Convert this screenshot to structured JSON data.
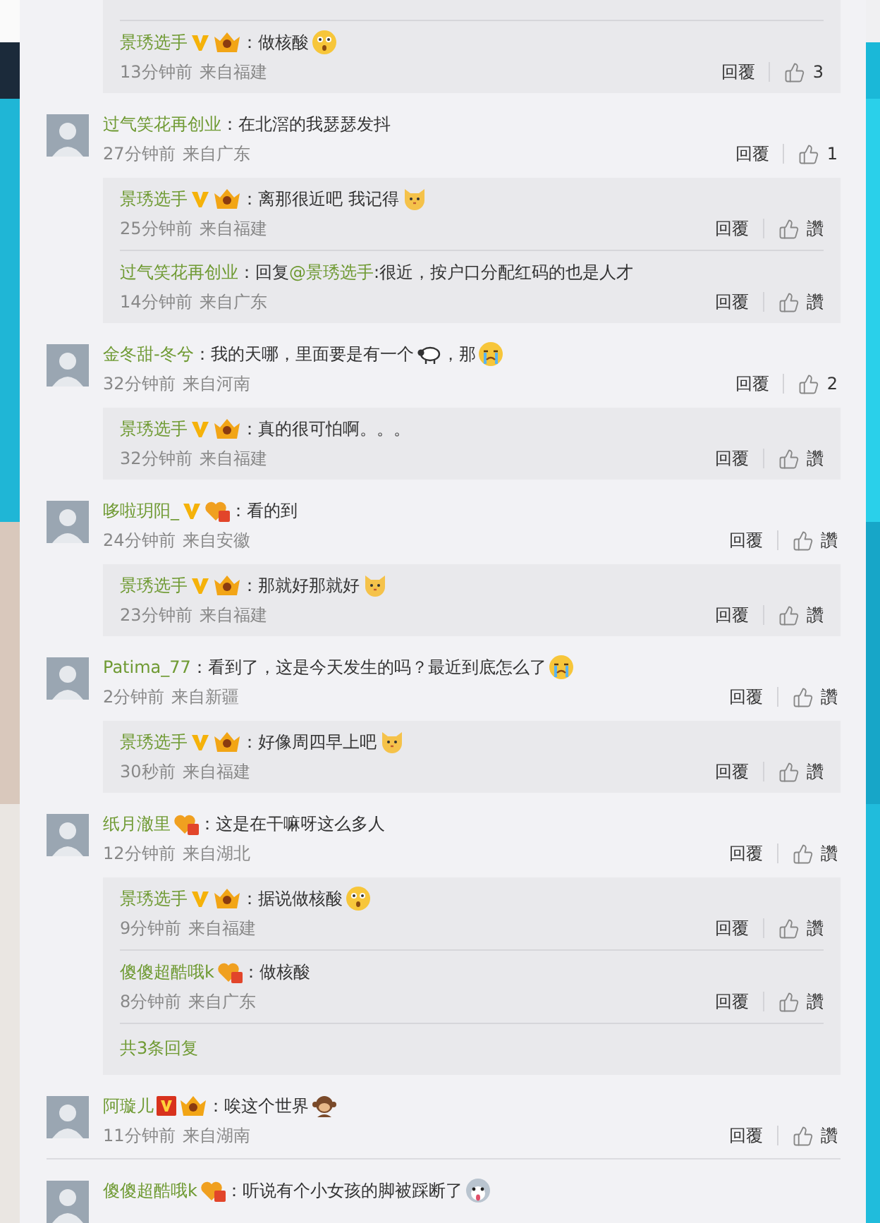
{
  "continued_replies": [
    {
      "user": "景琇选手",
      "badges": [
        {
          "kind": "v"
        },
        {
          "kind": "crown"
        }
      ],
      "content": [
        {
          "kind": "text",
          "text": "：做核酸"
        },
        {
          "kind": "surprised"
        }
      ],
      "time": "13分钟前",
      "source": "来自福建",
      "reply_label": "回覆",
      "like": "3"
    }
  ],
  "comments": [
    {
      "user": "过气笑花再创业",
      "content": [
        {
          "kind": "text",
          "text": "：在北滘的我瑟瑟发抖"
        }
      ],
      "time": "27分钟前",
      "source": "来自广东",
      "reply_label": "回覆",
      "like": "1",
      "replies": [
        {
          "user": "景琇选手",
          "badges": [
            {
              "kind": "v"
            },
            {
              "kind": "crown"
            }
          ],
          "content": [
            {
              "kind": "text",
              "text": "：离那很近吧 我记得"
            },
            {
              "kind": "cat"
            }
          ],
          "time": "25分钟前",
          "source": "来自福建",
          "reply_label": "回覆",
          "like": "讚"
        },
        {
          "user": "过气笑花再创业",
          "content": [
            {
              "kind": "text",
              "text": "：回复"
            },
            {
              "kind": "mention",
              "text": "@景琇选手"
            },
            {
              "kind": "text",
              "text": ":很近，按户口分配红码的也是人才"
            }
          ],
          "time": "14分钟前",
          "source": "来自广东",
          "reply_label": "回覆",
          "like": "讚"
        }
      ]
    },
    {
      "user": "金冬甜-冬兮",
      "content": [
        {
          "kind": "text",
          "text": "：我的天哪，里面要是有一个"
        },
        {
          "kind": "sheep"
        },
        {
          "kind": "text",
          "text": "，那"
        },
        {
          "kind": "crying"
        }
      ],
      "time": "32分钟前",
      "source": "来自河南",
      "reply_label": "回覆",
      "like": "2",
      "replies": [
        {
          "user": "景琇选手",
          "badges": [
            {
              "kind": "v"
            },
            {
              "kind": "crown"
            }
          ],
          "content": [
            {
              "kind": "text",
              "text": "：真的很可怕啊。。。"
            }
          ],
          "time": "32分钟前",
          "source": "来自福建",
          "reply_label": "回覆",
          "like": "讚"
        }
      ]
    },
    {
      "user": "哆啦玥阳_",
      "badges": [
        {
          "kind": "v"
        },
        {
          "kind": "heart"
        }
      ],
      "content": [
        {
          "kind": "text",
          "text": "：看的到"
        }
      ],
      "time": "24分钟前",
      "source": "来自安徽",
      "reply_label": "回覆",
      "like": "讚",
      "replies": [
        {
          "user": "景琇选手",
          "badges": [
            {
              "kind": "v"
            },
            {
              "kind": "crown"
            }
          ],
          "content": [
            {
              "kind": "text",
              "text": "：那就好那就好"
            },
            {
              "kind": "cat"
            }
          ],
          "time": "23分钟前",
          "source": "来自福建",
          "reply_label": "回覆",
          "like": "讚"
        }
      ]
    },
    {
      "user": "Patima_77",
      "content": [
        {
          "kind": "text",
          "text": "：看到了，这是今天发生的吗？最近到底怎么了"
        },
        {
          "kind": "crying"
        }
      ],
      "time": "2分钟前",
      "source": "来自新疆",
      "reply_label": "回覆",
      "like": "讚",
      "replies": [
        {
          "user": "景琇选手",
          "badges": [
            {
              "kind": "v"
            },
            {
              "kind": "crown"
            }
          ],
          "content": [
            {
              "kind": "text",
              "text": "：好像周四早上吧"
            },
            {
              "kind": "cat"
            }
          ],
          "time": "30秒前",
          "source": "来自福建",
          "reply_label": "回覆",
          "like": "讚"
        }
      ]
    },
    {
      "user": "纸月澈里",
      "badges": [
        {
          "kind": "heart"
        }
      ],
      "content": [
        {
          "kind": "text",
          "text": "：这是在干嘛呀这么多人"
        }
      ],
      "time": "12分钟前",
      "source": "来自湖北",
      "reply_label": "回覆",
      "like": "讚",
      "replies": [
        {
          "user": "景琇选手",
          "badges": [
            {
              "kind": "v"
            },
            {
              "kind": "crown"
            }
          ],
          "content": [
            {
              "kind": "text",
              "text": "：据说做核酸"
            },
            {
              "kind": "surprised"
            }
          ],
          "time": "9分钟前",
          "source": "来自福建",
          "reply_label": "回覆",
          "like": "讚"
        },
        {
          "user": "傻傻超酷哦k",
          "badges": [
            {
              "kind": "heart"
            }
          ],
          "content": [
            {
              "kind": "text",
              "text": "：做核酸"
            }
          ],
          "time": "8分钟前",
          "source": "来自广东",
          "reply_label": "回覆",
          "like": "讚"
        }
      ],
      "more": "共3条回复"
    },
    {
      "user": "阿璇儿",
      "badges": [
        {
          "kind": "v-box"
        },
        {
          "kind": "crown"
        }
      ],
      "content": [
        {
          "kind": "text",
          "text": "：唉这个世界"
        },
        {
          "kind": "monkey"
        }
      ],
      "time": "11分钟前",
      "source": "来自湖南",
      "reply_label": "回覆",
      "like": "讚"
    },
    {
      "user": "傻傻超酷哦k",
      "badges": [
        {
          "kind": "heart"
        }
      ],
      "content": [
        {
          "kind": "text",
          "text": "：听说有个小女孩的脚被踩断了"
        },
        {
          "kind": "dog"
        }
      ]
    }
  ]
}
